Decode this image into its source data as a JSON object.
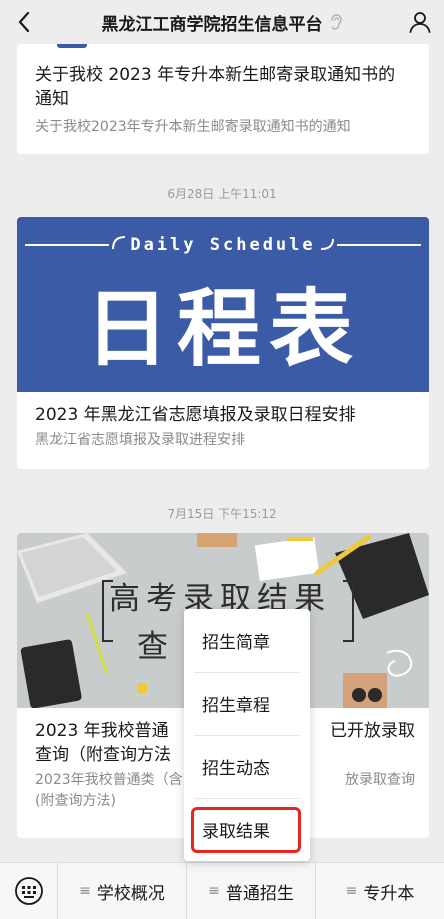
{
  "topbar": {
    "title": "黑龙江工商学院招生信息平台",
    "back_icon": "back-chevron-icon",
    "ear_icon": "ear-icon",
    "profile_icon": "profile-icon"
  },
  "articles": [
    {
      "title": "关于我校 2023 年专升本新生邮寄录取通知书的通知",
      "summary": "关于我校2023年专升本新生邮寄录取通知书的通知"
    },
    {
      "time": "6月28日 上午11:01",
      "banner_en": "Daily Schedule",
      "banner_cn": "日程表",
      "title": "2023 年黑龙江省志愿填报及录取日程安排",
      "summary": "黑龙江省志愿填报及录取进程安排"
    },
    {
      "time": "7月15日 下午15:12",
      "banner_line1": "高考录取结果",
      "banner_line2": "查",
      "title_left": "2023 年我校普通",
      "title_right": "已开放录取",
      "title_line2": "查询（附查询方法",
      "summary_left": "2023年我校普通类（含",
      "summary_right": "放录取查询",
      "summary_line2": "(附查询方法)"
    }
  ],
  "popup_menu": {
    "items": [
      "招生简章",
      "招生章程",
      "招生动态",
      "录取结果"
    ],
    "highlighted": "录取结果",
    "highlight_color": "#e8251f"
  },
  "bottom_bar": {
    "keyboard_icon": "keyboard-icon",
    "tabs": [
      "学校概况",
      "普通招生",
      "专升本"
    ],
    "tab_icon": "≡"
  },
  "colors": {
    "banner_blue": "#3b5ba6",
    "background": "#ededed"
  }
}
